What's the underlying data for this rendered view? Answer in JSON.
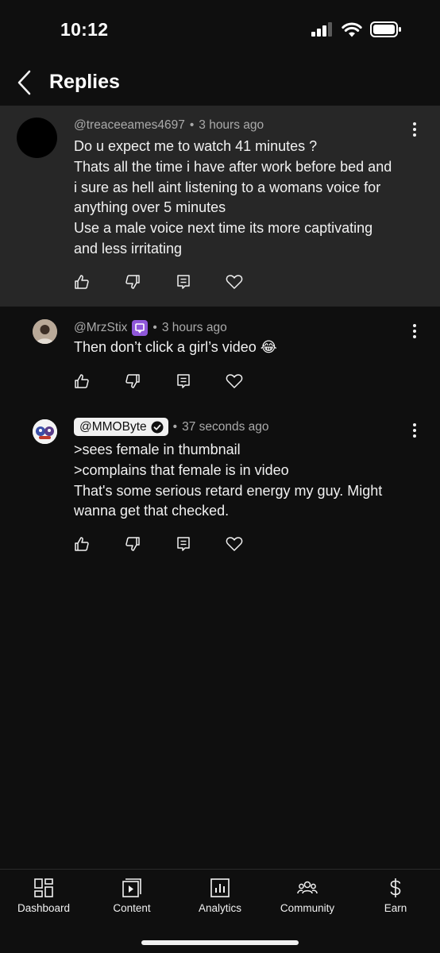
{
  "status_bar": {
    "time": "10:12"
  },
  "header": {
    "title": "Replies"
  },
  "parent_comment": {
    "handle": "@treaceeames4697",
    "separator": "•",
    "time": "3 hours ago",
    "lines": [
      "Do u expect me to watch 41 minutes ?",
      "Thats all the time i have after work before bed and",
      "i sure as hell aint listening to a womans voice for",
      "anything over 5 minutes",
      "Use a male voice next time its more captivating",
      "and less irritating"
    ]
  },
  "replies": [
    {
      "handle": "@MrzStix",
      "separator": "•",
      "time": "3 hours ago",
      "lines": [
        "Then don’t click a girl’s video 😂"
      ]
    },
    {
      "handle": "@MMOByte",
      "separator": "•",
      "time": "37 seconds ago",
      "lines": [
        ">sees female in thumbnail",
        ">complains that female is in video",
        "That's some serious retard energy my guy. Might",
        "wanna get that checked."
      ]
    }
  ],
  "bottom_nav": [
    {
      "label": "Dashboard",
      "icon": "dashboard-icon"
    },
    {
      "label": "Content",
      "icon": "content-icon"
    },
    {
      "label": "Analytics",
      "icon": "analytics-icon"
    },
    {
      "label": "Community",
      "icon": "community-icon"
    },
    {
      "label": "Earn",
      "icon": "earn-icon"
    }
  ],
  "colors": {
    "background": "#0f0f0f",
    "highlight": "#272727",
    "text": "#f1f1f1",
    "secondary_text": "#aaaaaa",
    "member_badge": "#8f57d9"
  }
}
